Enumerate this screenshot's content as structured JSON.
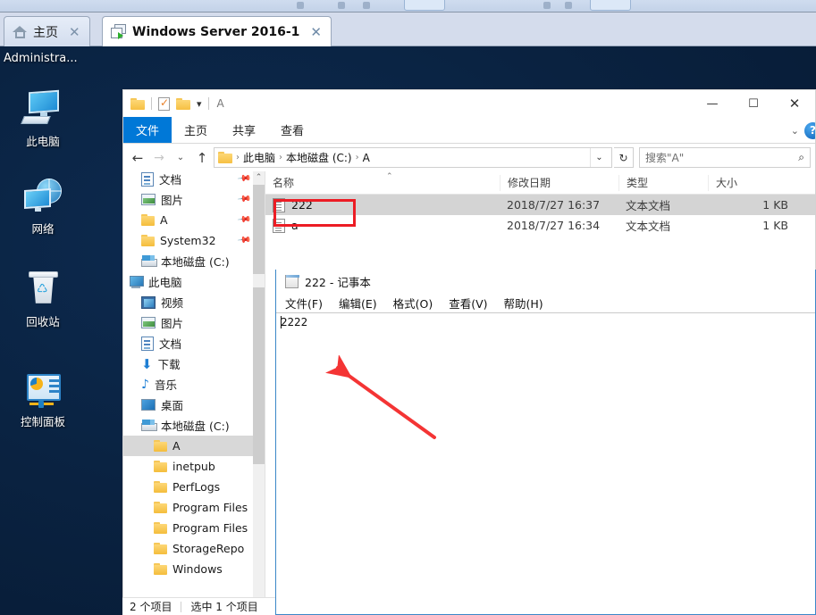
{
  "vm": {
    "tabs": [
      {
        "label": "主页",
        "icon": "home-icon",
        "active": false
      },
      {
        "label": "Windows Server 2016-1",
        "icon": "vm-window-icon",
        "active": true
      }
    ],
    "close_glyph": "✕"
  },
  "desktop": {
    "user_label": "Administra...",
    "icons": [
      {
        "name": "this-pc",
        "label": "此电脑"
      },
      {
        "name": "network",
        "label": "网络"
      },
      {
        "name": "recycle-bin",
        "label": "回收站"
      },
      {
        "name": "control-panel",
        "label": "控制面板"
      }
    ]
  },
  "explorer": {
    "quick_access": {
      "title": "A",
      "items": [
        "folder-icon",
        "properties-icon",
        "new-folder-icon",
        "customize-dropdown-icon"
      ]
    },
    "window_buttons": {
      "minimize": "—",
      "maximize": "☐",
      "close": "✕"
    },
    "ribbon": {
      "tabs": [
        "文件",
        "主页",
        "共享",
        "查看"
      ],
      "active_tab": "文件",
      "collapse_glyph": "⌄",
      "help_glyph": "?"
    },
    "address": {
      "back": "←",
      "forward": "→",
      "recent": "⌄",
      "up": "↑",
      "crumbs": [
        "此电脑",
        "本地磁盘 (C:)",
        "A"
      ],
      "separator": "›",
      "dropdown": "⌄",
      "refresh": "↻"
    },
    "search": {
      "placeholder": "搜索\"A\"",
      "icon": "search-icon"
    },
    "nav_pane": {
      "items": [
        {
          "label": "文档",
          "icon": "document-icon",
          "indent": 1,
          "pinned": true,
          "selected": false
        },
        {
          "label": "图片",
          "icon": "picture-icon",
          "indent": 1,
          "pinned": true,
          "selected": false
        },
        {
          "label": "A",
          "icon": "folder-icon",
          "indent": 1,
          "pinned": true,
          "selected": false
        },
        {
          "label": "System32",
          "icon": "folder-icon",
          "indent": 1,
          "pinned": true,
          "selected": false
        },
        {
          "label": "本地磁盘 (C:)",
          "icon": "drive-icon",
          "indent": 1,
          "pinned": false,
          "selected": false
        },
        {
          "label": "此电脑",
          "icon": "pc-icon",
          "indent": 0,
          "pinned": false,
          "selected": false
        },
        {
          "label": "视频",
          "icon": "video-icon",
          "indent": 1,
          "pinned": false,
          "selected": false
        },
        {
          "label": "图片",
          "icon": "picture-icon",
          "indent": 1,
          "pinned": false,
          "selected": false
        },
        {
          "label": "文档",
          "icon": "document-icon",
          "indent": 1,
          "pinned": false,
          "selected": false
        },
        {
          "label": "下载",
          "icon": "download-icon",
          "indent": 1,
          "pinned": false,
          "selected": false
        },
        {
          "label": "音乐",
          "icon": "music-icon",
          "indent": 1,
          "pinned": false,
          "selected": false
        },
        {
          "label": "桌面",
          "icon": "desktop-icon",
          "indent": 1,
          "pinned": false,
          "selected": false
        },
        {
          "label": "本地磁盘 (C:)",
          "icon": "drive-icon",
          "indent": 1,
          "pinned": false,
          "selected": false
        },
        {
          "label": "A",
          "icon": "folder-icon",
          "indent": 2,
          "pinned": false,
          "selected": true
        },
        {
          "label": "inetpub",
          "icon": "folder-icon",
          "indent": 2,
          "pinned": false,
          "selected": false
        },
        {
          "label": "PerfLogs",
          "icon": "folder-icon",
          "indent": 2,
          "pinned": false,
          "selected": false
        },
        {
          "label": "Program Files",
          "icon": "folder-icon",
          "indent": 2,
          "pinned": false,
          "selected": false
        },
        {
          "label": "Program Files",
          "icon": "folder-icon",
          "indent": 2,
          "pinned": false,
          "selected": false
        },
        {
          "label": "StorageRepo",
          "icon": "folder-icon",
          "indent": 2,
          "pinned": false,
          "selected": false
        },
        {
          "label": "Windows",
          "icon": "folder-icon",
          "indent": 2,
          "pinned": false,
          "selected": false
        }
      ],
      "scroll_up": "⌃",
      "scroll_down": "⌄"
    },
    "file_list": {
      "columns": [
        "名称",
        "修改日期",
        "类型",
        "大小"
      ],
      "sort_indicator": "⌃",
      "rows": [
        {
          "name": "222",
          "modified": "2018/7/27 16:37",
          "type": "文本文档",
          "size": "1 KB",
          "selected": true
        },
        {
          "name": "a",
          "modified": "2018/7/27 16:34",
          "type": "文本文档",
          "size": "1 KB",
          "selected": false
        }
      ]
    },
    "status": {
      "count": "2 个项目",
      "selection": "选中 1 个项目"
    }
  },
  "notepad": {
    "title": "222 - 记事本",
    "menu": [
      "文件(F)",
      "编辑(E)",
      "格式(O)",
      "查看(V)",
      "帮助(H)"
    ],
    "content": "2222"
  },
  "annotations": {
    "highlight_rect_target": "222",
    "arrow_color": "#ec1c24"
  }
}
